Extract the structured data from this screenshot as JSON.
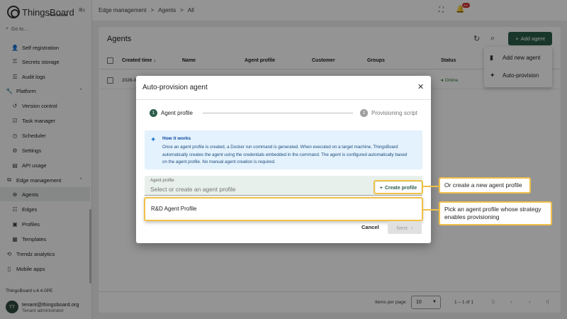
{
  "app": {
    "logo_text": "ThingsBoard",
    "logo_sub": "Professional",
    "menu_toggle_icon": "menu-collapse-icon",
    "accent_color": "#2c5e4a"
  },
  "sidebar": {
    "goto_placeholder": "Go to...",
    "items": [
      {
        "label": "Self registration",
        "icon": "person-add-icon"
      },
      {
        "label": "Secrets storage",
        "icon": "key-icon"
      },
      {
        "label": "Audit logs",
        "icon": "list-icon"
      },
      {
        "label": "Platform",
        "icon": "wrench-icon"
      },
      {
        "label": "Version control",
        "icon": "history-icon"
      },
      {
        "label": "Task manager",
        "icon": "tasks-icon"
      },
      {
        "label": "Scheduler",
        "icon": "clock-icon"
      },
      {
        "label": "Settings",
        "icon": "gear-icon"
      },
      {
        "label": "API usage",
        "icon": "chart-icon"
      },
      {
        "label": "Edge management",
        "icon": "edge-icon"
      },
      {
        "label": "Agents",
        "icon": "agents-icon"
      },
      {
        "label": "Edges",
        "icon": "edges-icon"
      },
      {
        "label": "Profiles",
        "icon": "profile-icon"
      },
      {
        "label": "Templates",
        "icon": "template-icon"
      },
      {
        "label": "Trendz analytics",
        "icon": "trendz-icon"
      },
      {
        "label": "Mobile apps",
        "icon": "mobile-icon"
      }
    ],
    "version": "ThingsBoard v.4.4.0PE",
    "user": {
      "initials": "TT",
      "email": "tenant@thingsboard.org",
      "role": "Tenant administrator"
    }
  },
  "topbar": {
    "breadcrumb": [
      "Edge management",
      ">",
      "Agents",
      ">",
      "All"
    ],
    "notification_badge": "99+"
  },
  "page": {
    "title": "Agents",
    "add_button": "Add agent",
    "columns": [
      "Created time",
      "Name",
      "Agent profile",
      "Customer",
      "Groups",
      "Status"
    ],
    "row": {
      "created": "2026-0",
      "status": "Online"
    },
    "status_color": "#2e7d32",
    "paginator": {
      "items_per_page_label": "Items per page:",
      "items_per_page": "10",
      "range": "1 – 1 of 1"
    }
  },
  "add_menu": {
    "items": [
      {
        "label": "Add new agent",
        "icon": "file-icon"
      },
      {
        "label": "Auto-provision",
        "icon": "magic-wand-icon"
      }
    ]
  },
  "dialog": {
    "title": "Auto-provision agent",
    "steps": [
      {
        "num": "1",
        "label": "Agent profile",
        "active": true
      },
      {
        "num": "2",
        "label": "Provisioning script",
        "active": false
      }
    ],
    "info_title": "How it works",
    "info_body": "Once an agent profile is created, a Docker run command is generated. When executed on a target machine, ThingsBoard automatically creates the agent using the credentials embedded in the command. The agent is configured automatically based on the agent profile. No manual agent creation is required.",
    "field_label": "Agent profile",
    "field_placeholder": "Select or create an agent profile",
    "create_profile_label": "Create profile",
    "option": "R&D Agent Profile",
    "cancel_label": "Cancel",
    "next_label": "Next"
  },
  "callouts": {
    "create": "Or create a new agent profile",
    "pick": "Pick an agent profile whose strategy enables provisioning"
  }
}
